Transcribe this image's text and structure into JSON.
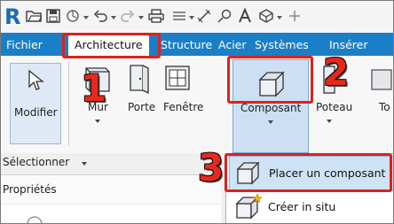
{
  "app": {
    "logo_letter": "R"
  },
  "tabs": [
    {
      "label": "Fichier",
      "active": false
    },
    {
      "label": "Architecture",
      "active": true
    },
    {
      "label": "Structure",
      "active": false
    },
    {
      "label": "Acier",
      "active": false
    },
    {
      "label": "Systèmes",
      "active": false
    },
    {
      "label": "Insérer",
      "active": false
    }
  ],
  "ribbon": {
    "modifier": "Modifier",
    "mur": "Mur",
    "porte": "Porte",
    "fenetre": "Fenêtre",
    "composant": "Composant",
    "poteau": "Poteau",
    "partial_next": "To"
  },
  "panel_footer": {
    "selectionner": "Sélectionner"
  },
  "properties": {
    "title": "Propriétés"
  },
  "dropdown": {
    "items": [
      {
        "label": "Placer un composant",
        "highlighted": true
      },
      {
        "label": "Créer in situ",
        "highlighted": false
      }
    ]
  },
  "annotations": {
    "step1": "1",
    "step2": "2",
    "step3": "3"
  },
  "colors": {
    "ribbon_blue": "#1b7fc7",
    "annotation_red": "#e0201b",
    "highlight_blue": "#cfe3f7",
    "logo_blue": "#1f6ab0"
  }
}
